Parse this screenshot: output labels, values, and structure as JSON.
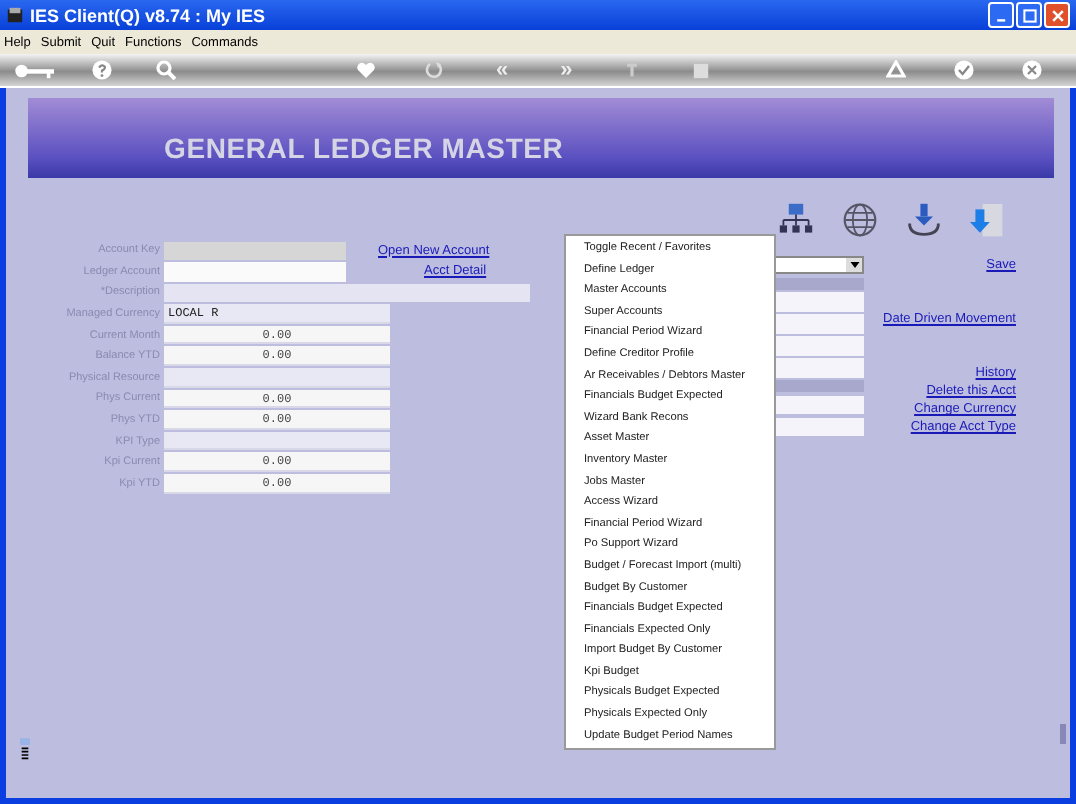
{
  "window": {
    "title": "IES Client(Q) v8.74 : My IES"
  },
  "menu_bar": [
    "Help",
    "Submit",
    "Quit",
    "Functions",
    "Commands"
  ],
  "toolbar": {
    "back_glyph": "«",
    "forward_glyph": "»"
  },
  "banner": {
    "title": "GENERAL LEDGER MASTER"
  },
  "form_fields": [
    {
      "label": "Account Key",
      "kind": "grey"
    },
    {
      "label": "Ledger Account",
      "kind": "white"
    },
    {
      "label": "*Description",
      "kind": "wide"
    },
    {
      "label": "Managed Currency",
      "kind": "text",
      "value": "LOCAL R"
    },
    {
      "label": "Current Month",
      "kind": "number",
      "value": "0.00"
    },
    {
      "label": "Balance YTD",
      "kind": "number",
      "value": "0.00"
    },
    {
      "label": "Physical Resource",
      "kind": "text"
    },
    {
      "label": "Phys Current",
      "kind": "number",
      "value": "0.00"
    },
    {
      "label": "Phys YTD",
      "kind": "number",
      "value": "0.00"
    },
    {
      "label": "KPI Type",
      "kind": "text"
    },
    {
      "label": "Kpi Current",
      "kind": "number",
      "value": "0.00"
    },
    {
      "label": "Kpi YTD",
      "kind": "number",
      "value": "0.00"
    }
  ],
  "form_links": [
    "Open New Account",
    "Acct Detail"
  ],
  "side_links": [
    "Save",
    "Date Driven Movement",
    "History",
    "Delete this Acct",
    "Change Currency",
    "Change Acct Type"
  ],
  "functions_menu": [
    "Toggle Recent / Favorites",
    "Define Ledger",
    "Master Accounts",
    "Super Accounts",
    "Financial Period Wizard",
    "Define Creditor Profile",
    "Ar Receivables / Debtors Master",
    "Financials Budget  Expected",
    "Wizard Bank Recons",
    "Asset Master",
    "Inventory Master",
    "Jobs Master",
    "Access Wizard",
    "Financial Period Wizard",
    "Po Support Wizard",
    "Budget / Forecast Import (multi)",
    "Budget By Customer",
    "Financials Budget  Expected",
    "Financials Expected Only",
    "Import Budget By Customer",
    "Kpi Budget",
    "Physicals Budget  Expected",
    "Physicals Expected Only",
    "Update Budget Period Names"
  ]
}
